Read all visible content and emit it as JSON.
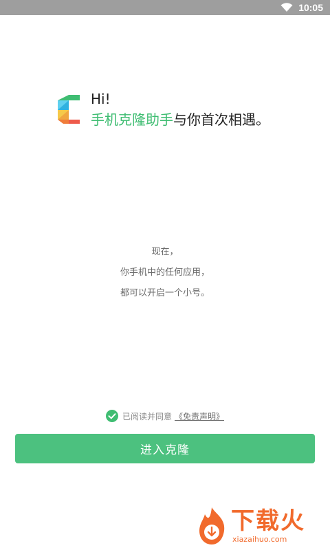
{
  "status_bar": {
    "time": "10:05",
    "wifi_icon": "wifi-icon"
  },
  "greeting": {
    "hi": "Hi!",
    "app_name": "手机克隆助手",
    "rest": "与你首次相遇。"
  },
  "description": {
    "line1": "现在，",
    "line2": "你手机中的任何应用，",
    "line3": "都可以开启一个小号。"
  },
  "agreement": {
    "checked": true,
    "text": "已阅读并同意",
    "link": "《免责声明》"
  },
  "enter_button": {
    "label": "进入克隆"
  },
  "watermark": {
    "title": "下载火",
    "url": "xiazaihuo.com"
  },
  "colors": {
    "accent": "#3fbd72",
    "button": "#4cc17f",
    "status_bar": "#9e9e9e",
    "watermark": "#f16a2c"
  }
}
